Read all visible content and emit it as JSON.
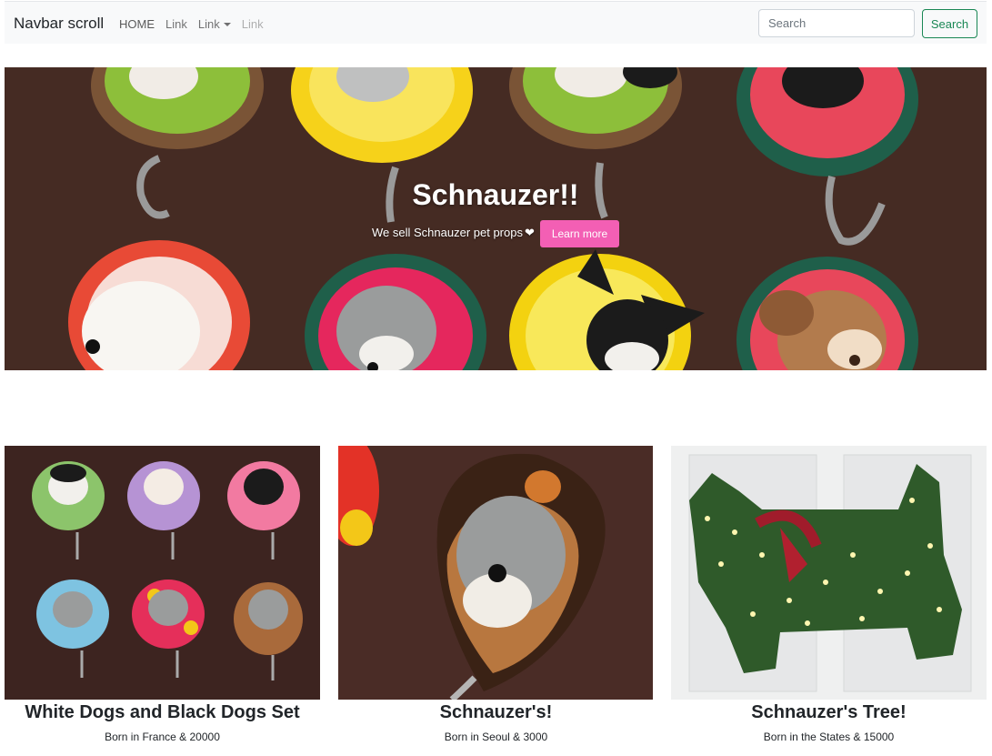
{
  "navbar": {
    "brand": "Navbar scroll",
    "links": [
      {
        "label": "HOME",
        "state": "active"
      },
      {
        "label": "Link",
        "state": "normal"
      },
      {
        "label": "Link",
        "state": "dropdown"
      },
      {
        "label": "Link",
        "state": "disabled"
      }
    ],
    "search_placeholder": "Search",
    "search_button": "Search"
  },
  "hero": {
    "title": "Schnauzer!!",
    "subtitle": "We sell Schnauzer pet props",
    "heart_icon": "heart-icon",
    "button_label": "Learn more",
    "button_color": "#f35fb4"
  },
  "cards": [
    {
      "title": "White Dogs and Black Dogs Set",
      "text": "Born in France & 20000"
    },
    {
      "title": "Schnauzer's!",
      "text": "Born in Seoul & 3000"
    },
    {
      "title": "Schnauzer's Tree!",
      "text": "Born in the States & 15000"
    }
  ],
  "colors": {
    "accent_green": "#198754",
    "navbar_bg": "#f8f9fa"
  }
}
